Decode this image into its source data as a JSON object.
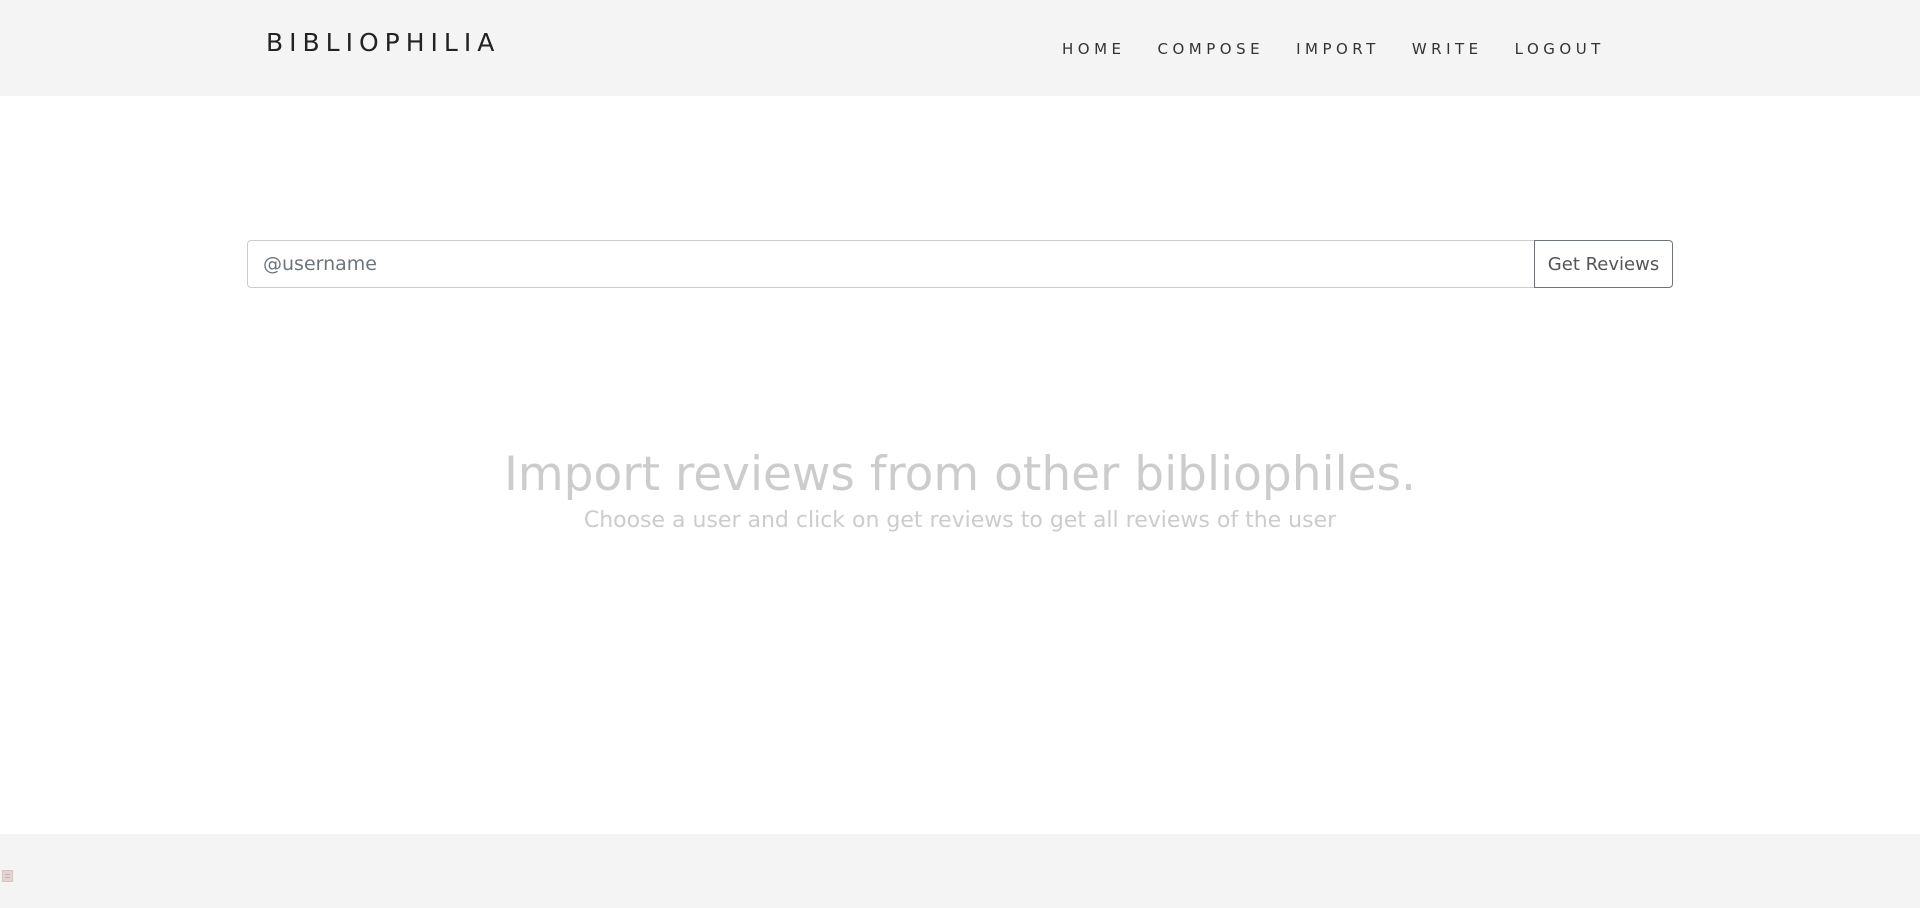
{
  "navbar": {
    "brand": "BIBLIOPHILIA",
    "links": [
      {
        "label": "HOME"
      },
      {
        "label": "COMPOSE"
      },
      {
        "label": "IMPORT"
      },
      {
        "label": "WRITE"
      },
      {
        "label": "LOGOUT"
      }
    ]
  },
  "search": {
    "placeholder": "@username",
    "value": "",
    "button_label": "Get Reviews"
  },
  "hero": {
    "title": "Import reviews from other bibliophiles.",
    "subtitle": "Choose a user and click on get reviews to get all reviews of the user"
  },
  "footer": {
    "icon": "broken-image-icon"
  },
  "colors": {
    "navbar_bg": "#f4f4f4",
    "hero_text": "#cccccc",
    "button_border": "#6c757d"
  }
}
